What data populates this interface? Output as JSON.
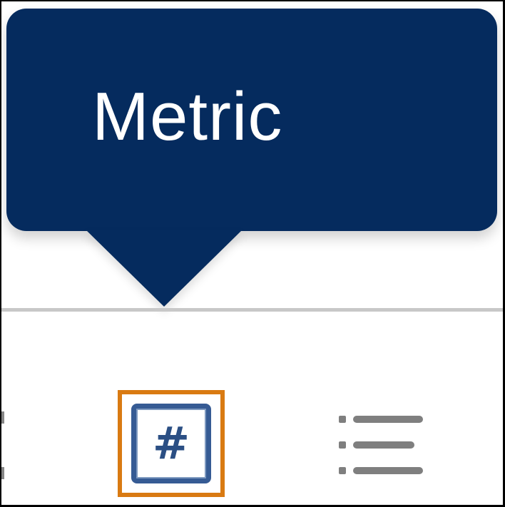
{
  "tooltip": {
    "label": "Metric"
  },
  "toolbar": {
    "metric_icon": "hash-icon",
    "list_icon": "list-icon"
  },
  "colors": {
    "tooltip_bg": "#052b5e",
    "selection_outline": "#d97a12",
    "metric_icon_border": "#365b94",
    "divider": "#c8c8c8",
    "list_icon": "#808080"
  }
}
